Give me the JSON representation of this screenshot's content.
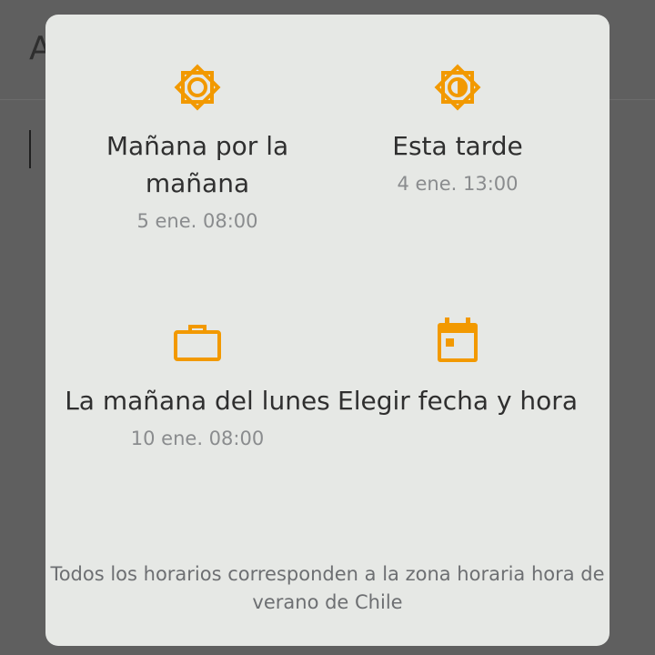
{
  "background": {
    "title_partial": "A"
  },
  "dialog": {
    "options": [
      {
        "icon": "sun-icon",
        "label": "Mañana por la mañana",
        "sub": "5 ene. 08:00"
      },
      {
        "icon": "half-sun-icon",
        "label": "Esta tarde",
        "sub": "4 ene. 13:00"
      },
      {
        "icon": "briefcase-icon",
        "label": "La mañana del lunes",
        "sub": "10 ene. 08:00"
      },
      {
        "icon": "calendar-icon",
        "label": "Elegir fecha y hora",
        "sub": ""
      }
    ],
    "footer": "Todos los horarios corresponden a la zona horaria hora de verano de Chile"
  },
  "colors": {
    "accent": "#f29900",
    "dialog_bg": "#e6e8e5",
    "scrim": "#5f5f5f",
    "text_primary": "#2f2f2f",
    "text_secondary": "#8a8c8e"
  }
}
